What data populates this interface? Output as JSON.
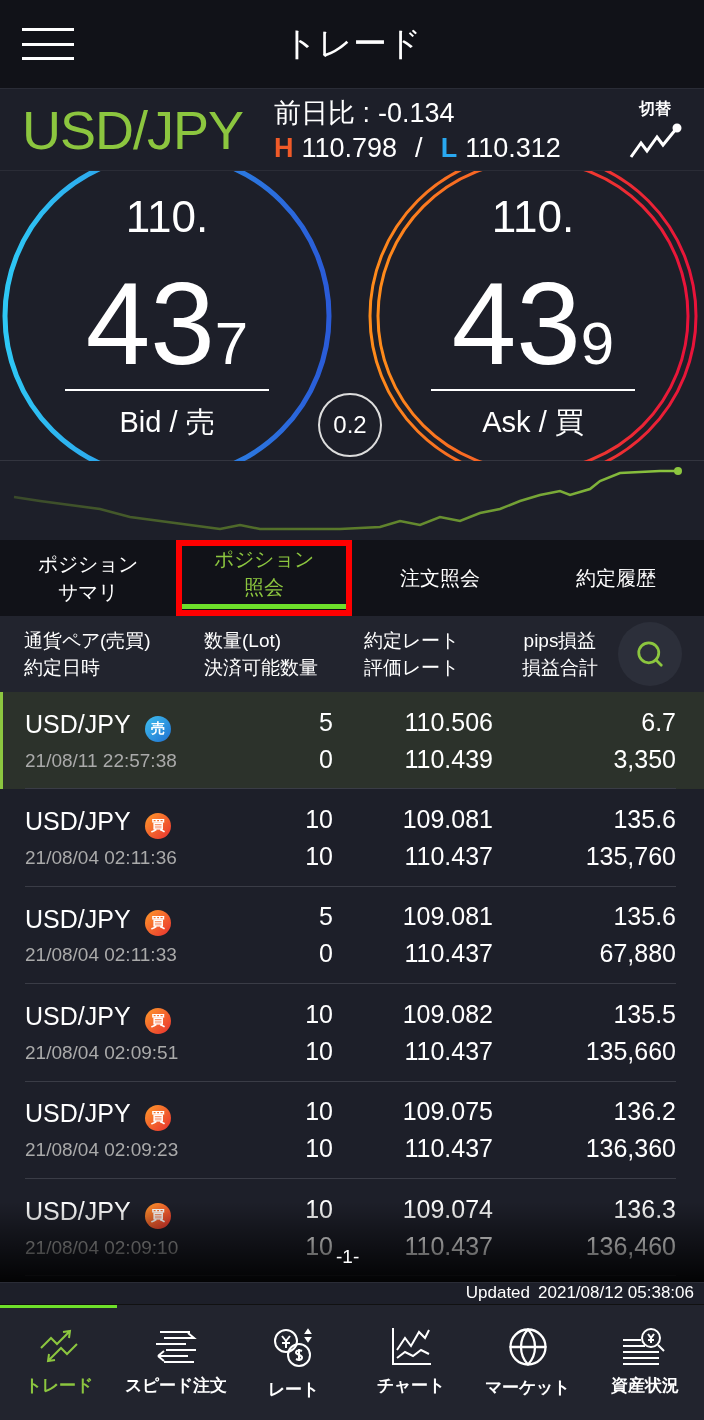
{
  "header": {
    "title": "トレード"
  },
  "quote": {
    "pair": "USD/JPY",
    "change_label": "前日比 :",
    "change": "-0.134",
    "high_label": "H",
    "high": "110.798",
    "separator": "/",
    "low_label": "L",
    "low": "110.312",
    "switch_label": "切替"
  },
  "rates": [
    {
      "kind": "bid",
      "prefix": "110.",
      "big": "43",
      "small": "7",
      "label": "Bid / 売"
    },
    {
      "kind": "ask",
      "prefix": "110.",
      "big": "43",
      "small": "9",
      "label": "Ask / 買"
    }
  ],
  "spread": "0.2",
  "tabs": [
    {
      "lines": [
        "ポジション",
        "サマリ"
      ],
      "selected": false,
      "highlighted": false
    },
    {
      "lines": [
        "ポジション",
        "照会"
      ],
      "selected": true,
      "highlighted": true
    },
    {
      "lines": [
        "注文照会"
      ],
      "selected": false,
      "highlighted": false
    },
    {
      "lines": [
        "約定履歴"
      ],
      "selected": false,
      "highlighted": false
    }
  ],
  "columns": [
    {
      "top": "通貨ペア(売買)",
      "bottom": "約定日時"
    },
    {
      "top": "数量(Lot)",
      "bottom": "決済可能数量"
    },
    {
      "top": "約定レート",
      "bottom": "評価レート"
    },
    {
      "top": "pips損益",
      "bottom": "損益合計"
    }
  ],
  "rows": [
    {
      "pair": "USD/JPY",
      "kind": "sell",
      "badge": "売",
      "time": "21/08/11 22:57:38",
      "lots": "5",
      "closable": "0",
      "rate": "110.506",
      "eval_rate": "110.439",
      "pips": "6.7",
      "pnl": "3,350",
      "selected": true
    },
    {
      "pair": "USD/JPY",
      "kind": "buy",
      "badge": "買",
      "time": "21/08/04 02:11:36",
      "lots": "10",
      "closable": "10",
      "rate": "109.081",
      "eval_rate": "110.437",
      "pips": "135.6",
      "pnl": "135,760",
      "selected": false
    },
    {
      "pair": "USD/JPY",
      "kind": "buy",
      "badge": "買",
      "time": "21/08/04 02:11:33",
      "lots": "5",
      "closable": "0",
      "rate": "109.081",
      "eval_rate": "110.437",
      "pips": "135.6",
      "pnl": "67,880",
      "selected": false
    },
    {
      "pair": "USD/JPY",
      "kind": "buy",
      "badge": "買",
      "time": "21/08/04 02:09:51",
      "lots": "10",
      "closable": "10",
      "rate": "109.082",
      "eval_rate": "110.437",
      "pips": "135.5",
      "pnl": "135,660",
      "selected": false
    },
    {
      "pair": "USD/JPY",
      "kind": "buy",
      "badge": "買",
      "time": "21/08/04 02:09:23",
      "lots": "10",
      "closable": "10",
      "rate": "109.075",
      "eval_rate": "110.437",
      "pips": "136.2",
      "pnl": "136,360",
      "selected": false
    },
    {
      "pair": "USD/JPY",
      "kind": "buy",
      "badge": "買",
      "time": "21/08/04 02:09:10",
      "lots": "10",
      "closable": "10",
      "rate": "109.074",
      "eval_rate": "110.437",
      "pips": "136.3",
      "pnl": "136,460",
      "selected": false
    }
  ],
  "page": "-1-",
  "updated": {
    "label": "Updated",
    "time": "2021/08/12 05:38:06"
  },
  "nav": [
    {
      "kind": "trade",
      "label": "トレード",
      "selected": true
    },
    {
      "kind": "speed",
      "label": "スピード注文",
      "selected": false
    },
    {
      "kind": "rate",
      "label": "レート",
      "selected": false
    },
    {
      "kind": "chart",
      "label": "チャート",
      "selected": false
    },
    {
      "kind": "market",
      "label": "マーケット",
      "selected": false
    },
    {
      "kind": "assets",
      "label": "資産状況",
      "selected": false
    }
  ]
}
